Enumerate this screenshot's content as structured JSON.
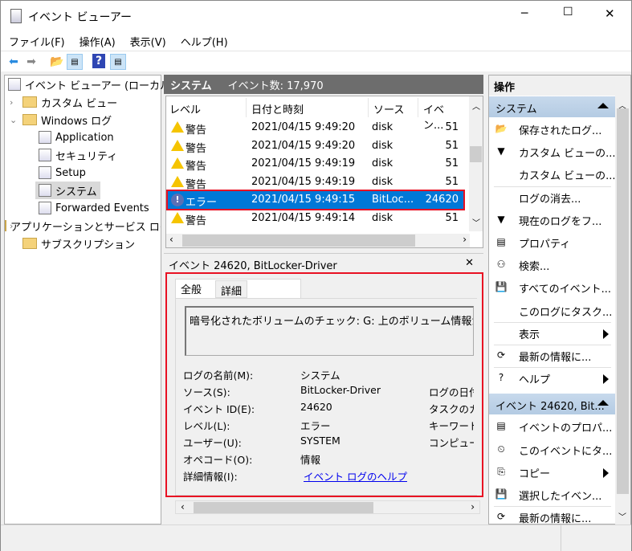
{
  "window": {
    "title": "イベント ビューアー",
    "minimize": "─",
    "maximize": "☐",
    "close": "✕"
  },
  "menu": [
    "ファイル(F)",
    "操作(A)",
    "表示(V)",
    "ヘルプ(H)"
  ],
  "tree": {
    "root": "イベント ビューアー (ローカル)",
    "custom_views": "カスタム ビュー",
    "windows_logs": "Windows ログ",
    "logs": [
      "Application",
      "セキュリティ",
      "Setup",
      "システム",
      "Forwarded Events"
    ],
    "app_service_logs": "アプリケーションとサービス ログ",
    "subscriptions": "サブスクリプション",
    "selected": "システム"
  },
  "list": {
    "header_title": "システム",
    "event_count": "イベント数: 17,970",
    "columns": [
      "レベル",
      "日付と時刻",
      "ソース",
      "イベン..."
    ],
    "rows": [
      {
        "level": "警告",
        "icon": "warning",
        "date": "2021/04/15 9:49:20",
        "source": "disk",
        "id": "51"
      },
      {
        "level": "警告",
        "icon": "warning",
        "date": "2021/04/15 9:49:20",
        "source": "disk",
        "id": "51"
      },
      {
        "level": "警告",
        "icon": "warning",
        "date": "2021/04/15 9:49:19",
        "source": "disk",
        "id": "51"
      },
      {
        "level": "警告",
        "icon": "warning",
        "date": "2021/04/15 9:49:19",
        "source": "disk",
        "id": "51"
      },
      {
        "level": "エラー",
        "icon": "error",
        "date": "2021/04/15 9:49:15",
        "source": "BitLoc...",
        "id": "24620",
        "selected": true
      },
      {
        "level": "警告",
        "icon": "warning",
        "date": "2021/04/15 9:49:14",
        "source": "disk",
        "id": "51"
      }
    ]
  },
  "detail": {
    "title": "イベント 24620, BitLocker-Driver",
    "close": "✕",
    "tabs": [
      "全般",
      "詳細"
    ],
    "message": "暗号化されたボリュームのチェック: G: 上のボリューム情報が読み取",
    "fields": [
      {
        "label": "ログの名前(M):",
        "value": "システム"
      },
      {
        "label": "ソース(S):",
        "value": "BitLocker-Driver",
        "right": "ログの日付"
      },
      {
        "label": "イベント ID(E):",
        "value": "24620",
        "right": "タスクのカテ"
      },
      {
        "label": "レベル(L):",
        "value": "エラー",
        "right": "キーワード"
      },
      {
        "label": "ユーザー(U):",
        "value": "SYSTEM",
        "right": "コンピュータ"
      },
      {
        "label": "オペコード(O):",
        "value": "情報"
      },
      {
        "label": "詳細情報(I):",
        "value": "イベント ログのヘルプ"
      }
    ]
  },
  "actions": {
    "title": "操作",
    "section1": {
      "title": "システム",
      "items": [
        "保存されたログ...",
        "カスタム ビューの...",
        "カスタム ビューの...",
        "ログの消去...",
        "現在のログをフ...",
        "プロパティ",
        "検索...",
        "すべてのイベント...",
        "このログにタスク...",
        "表示",
        "最新の情報に...",
        "ヘルプ"
      ]
    },
    "section2": {
      "title": "イベント 24620, Bit...",
      "items": [
        "イベントのプロパ...",
        "このイベントにタ...",
        "コピー",
        "選択したイベン...",
        "最新の情報に..."
      ]
    }
  }
}
